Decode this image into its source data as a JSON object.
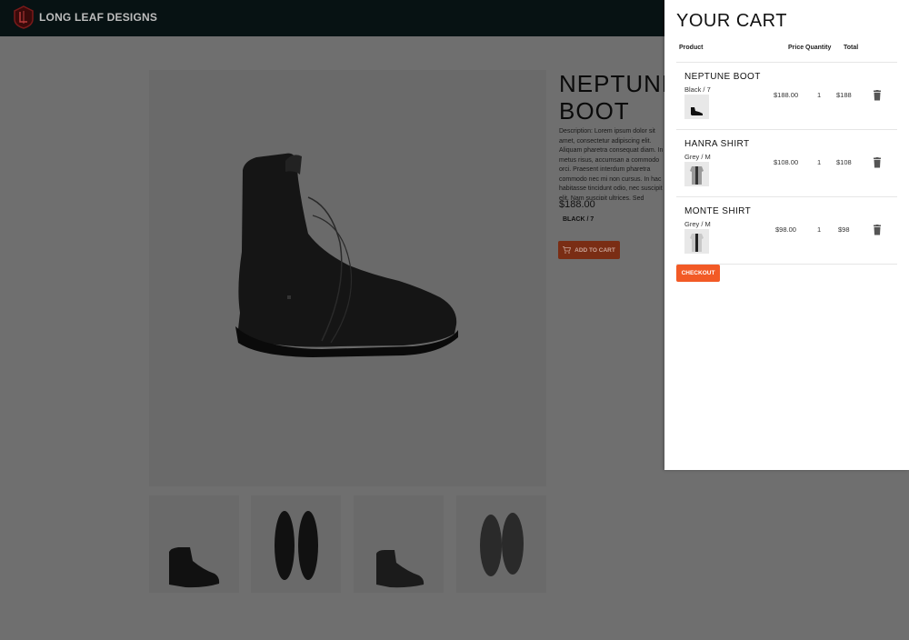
{
  "header": {
    "brand": "LONG LEAF DESIGNS",
    "logo_icon": "shield-logo-icon"
  },
  "product": {
    "title_line1": "NEPTUNE",
    "title_line2": "BOOT",
    "description": "Description: Lorem ipsum dolor sit amet, consectetur adipiscing elit. Aliquam pharetra consequat diam. In metus risus, accumsan a commodo orci. Praesent interdum pharetra commodo nec mi non cursus. In hac habitasse tincidunt odio, nec suscipit elit. Nam suscipit ultrices. Sed convallis eget dui consectetur dolor. Duis suscipit pulvinar mi a tristique",
    "price": "$188.00",
    "variant": "BLACK / 7",
    "add_to_cart_label": "ADD TO CART"
  },
  "cart": {
    "title": "YOUR CART",
    "columns": {
      "product": "Product",
      "price": "Price",
      "quantity": "Quantity",
      "total": "Total"
    },
    "items": [
      {
        "name": "NEPTUNE BOOT",
        "variant": "Black / 7",
        "price": "$188.00",
        "quantity": "1",
        "total": "$188"
      },
      {
        "name": "HANRA SHIRT",
        "variant": "Grey / M",
        "price": "$108.00",
        "quantity": "1",
        "total": "$108"
      },
      {
        "name": "MONTE SHIRT",
        "variant": "Grey / M",
        "price": "$98.00",
        "quantity": "1",
        "total": "$98"
      }
    ],
    "checkout_label": "CHECKOUT"
  },
  "colors": {
    "header_bg": "#071213",
    "checkout": "#f25a26",
    "add_to_cart_dimmed": "#7a2d14"
  }
}
